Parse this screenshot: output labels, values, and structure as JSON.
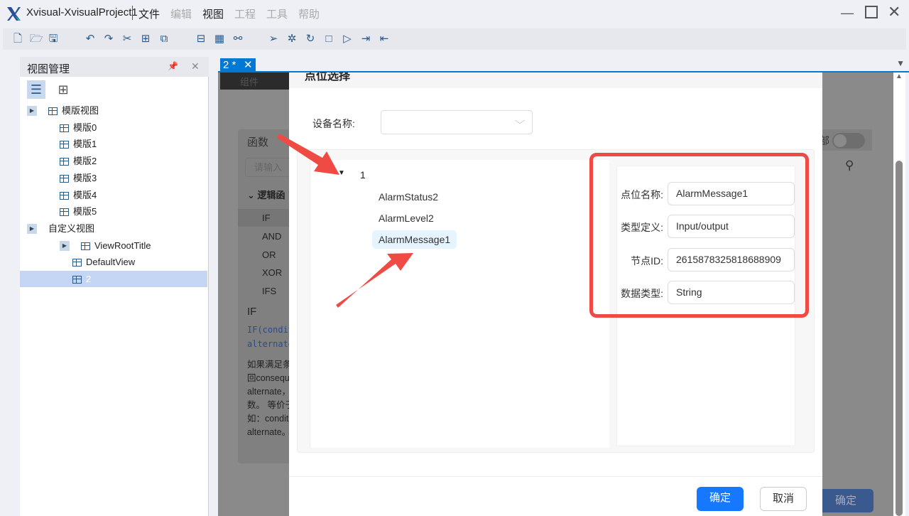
{
  "app": {
    "title": "Xvisual-XvisualProject1",
    "menus": [
      {
        "label": "文件",
        "enabled": true
      },
      {
        "label": "编辑",
        "enabled": false
      },
      {
        "label": "视图",
        "enabled": true
      },
      {
        "label": "工程",
        "enabled": false
      },
      {
        "label": "工具",
        "enabled": false
      },
      {
        "label": "帮助",
        "enabled": false
      }
    ]
  },
  "left_panel": {
    "title": "视图管理",
    "tree": [
      {
        "label": "模版视图",
        "level": 0,
        "expander": true,
        "icon": "template-view-icon"
      },
      {
        "label": "模版0",
        "level": 1,
        "icon": "table-icon"
      },
      {
        "label": "模版1",
        "level": 1,
        "icon": "table-icon"
      },
      {
        "label": "模版2",
        "level": 1,
        "icon": "table-icon"
      },
      {
        "label": "模版3",
        "level": 1,
        "icon": "table-icon"
      },
      {
        "label": "模版4",
        "level": 1,
        "icon": "table-icon"
      },
      {
        "label": "模版5",
        "level": 1,
        "icon": "table-icon"
      },
      {
        "label": "自定义视图",
        "level": 0,
        "expander": true
      },
      {
        "label": "ViewRootTitle",
        "level": 1,
        "expander": true,
        "icon": "folder-icon"
      },
      {
        "label": "DefaultView",
        "level": 2,
        "icon": "table-icon"
      },
      {
        "label": "2",
        "level": 2,
        "icon": "table-icon",
        "selected": true
      }
    ]
  },
  "editor": {
    "tab_label": "2 *",
    "components_label": "组件",
    "background": {
      "functions_title": "函数",
      "search_placeholder": "请输入",
      "group_label": "逻辑函",
      "items": [
        "IF",
        "AND",
        "OR",
        "XOR",
        "IFS"
      ],
      "detail_title": "IF",
      "detail_code": [
        "IF(condit",
        "alternate"
      ],
      "detail_text": [
        "如果满足条",
        "回consequ",
        "alternate，",
        "数。 等价于",
        "如：condit",
        "alternate。"
      ],
      "toggle_label": "部",
      "confirm_label": "确定"
    }
  },
  "modal": {
    "title": "点位选择",
    "device_label": "设备名称:",
    "device_value": "",
    "tree": {
      "root": "1",
      "children": [
        "AlarmStatus2",
        "AlarmLevel2",
        "AlarmMessage1"
      ],
      "selected": "AlarmMessage1"
    },
    "fields": [
      {
        "label": "点位名称:",
        "value": "AlarmMessage1"
      },
      {
        "label": "类型定义:",
        "value": "Input/output"
      },
      {
        "label": "节点ID:",
        "value": "2615878325818688909"
      },
      {
        "label": "数据类型:",
        "value": "String"
      }
    ],
    "ok_label": "确定",
    "cancel_label": "取消"
  },
  "colors": {
    "accent": "#1677ff",
    "tab": "#0078d4",
    "annotation": "#f04a45"
  }
}
